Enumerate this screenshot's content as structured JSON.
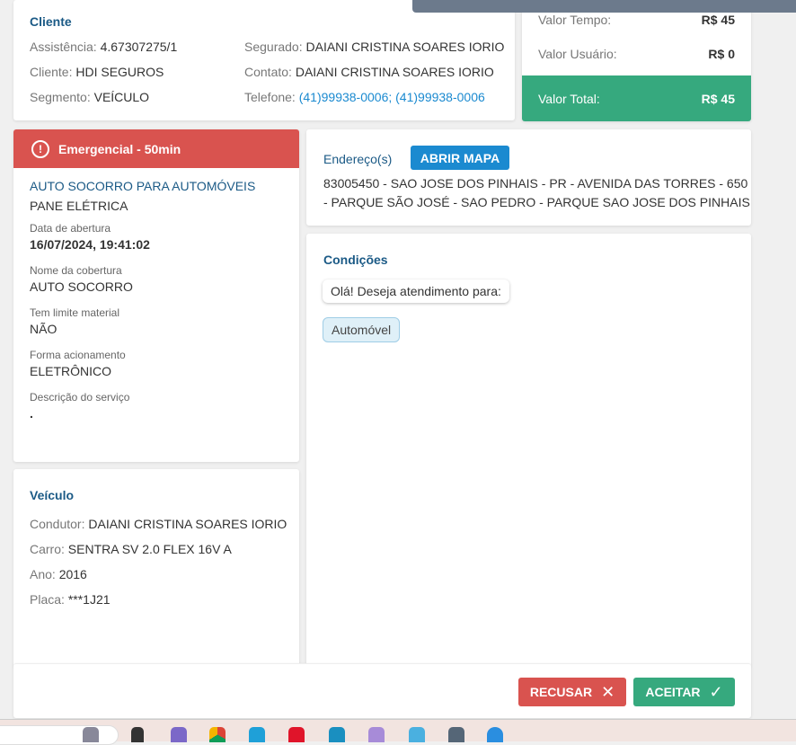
{
  "cliente": {
    "title": "Cliente",
    "left": [
      {
        "label": "Assistência:",
        "value": "4.67307275/1"
      },
      {
        "label": "Cliente:",
        "value": "HDI SEGUROS"
      },
      {
        "label": "Segmento:",
        "value": "VEÍCULO"
      }
    ],
    "right": [
      {
        "label": "Segurado:",
        "value": "DAIANI CRISTINA SOARES IORIO"
      },
      {
        "label": "Contato:",
        "value": "DAIANI CRISTINA SOARES IORIO"
      },
      {
        "label": "Telefone:",
        "value": "(41)99938-0006; (41)99938-0006"
      }
    ]
  },
  "valores": {
    "tempo_label": "Valor Tempo:",
    "tempo": "R$ 45",
    "usuario_label": "Valor Usuário:",
    "usuario": "R$ 0",
    "total_label": "Valor Total:",
    "total": "R$ 45"
  },
  "servico": {
    "badge": "Emergencial - 50min",
    "tipo": "AUTO SOCORRO PARA AUTOMÓVEIS",
    "problema": "PANE ELÉTRICA",
    "fields": [
      {
        "label": "Data de abertura",
        "value": "16/07/2024, 19:41:02"
      },
      {
        "label": "Nome da cobertura",
        "value": "AUTO SOCORRO"
      },
      {
        "label": "Tem limite material",
        "value": "NÃO"
      },
      {
        "label": "Forma acionamento",
        "value": "ELETRÔNICO"
      },
      {
        "label": "Descrição do serviço",
        "value": "."
      }
    ]
  },
  "endereco": {
    "title": "Endereço(s)",
    "map_button": "ABRIR MAPA",
    "line1": "83005450 - SAO JOSE DOS PINHAIS - PR - AVENIDA DAS TORRES - 650",
    "line2": "- PARQUE SÃO JOSÉ - SAO PEDRO - PARQUE SAO JOSE DOS PINHAIS"
  },
  "condicoes": {
    "title": "Condições",
    "message": "Olá! Deseja atendimento para:",
    "option": "Automóvel"
  },
  "veiculo": {
    "title": "Veículo",
    "fields": [
      {
        "label": "Condutor:",
        "value": "DAIANI CRISTINA SOARES IORIO"
      },
      {
        "label": "Carro:",
        "value": "SENTRA SV 2.0 FLEX 16V A"
      },
      {
        "label": "Ano:",
        "value": "2016"
      },
      {
        "label": "Placa:",
        "value": "***1J21"
      }
    ]
  },
  "actions": {
    "reject": "RECUSAR",
    "accept": "ACEITAR"
  },
  "colors": {
    "green": "#36a97e",
    "red": "#d9534f",
    "blue": "#1b8ad0"
  }
}
